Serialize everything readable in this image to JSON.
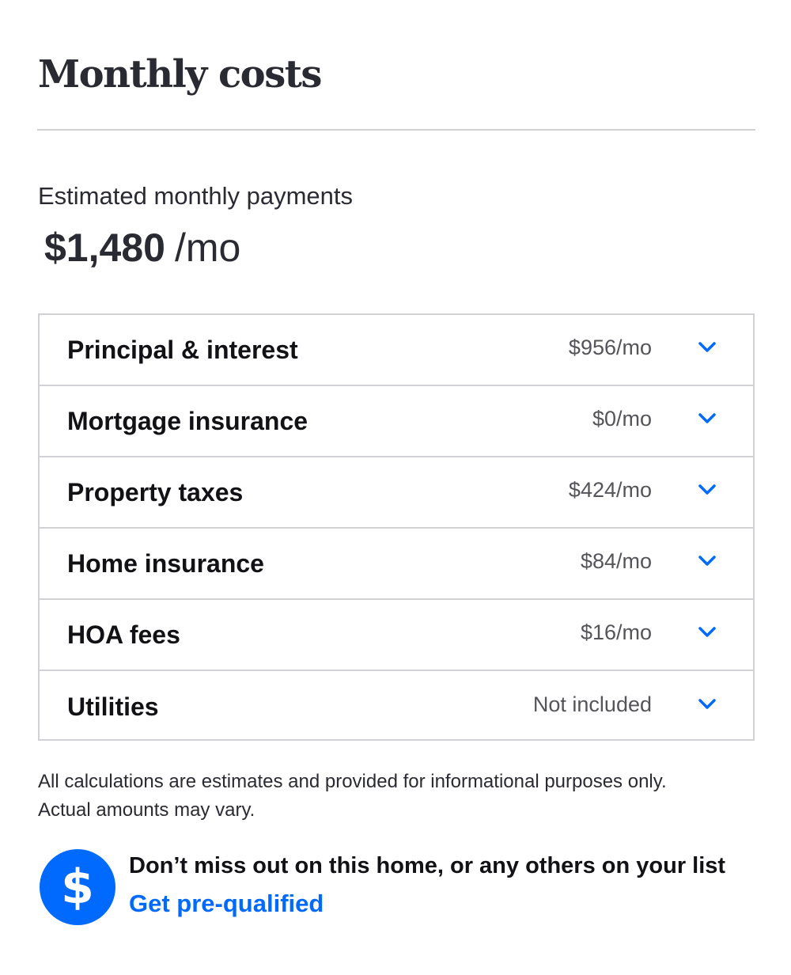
{
  "header": {
    "title": "Monthly costs"
  },
  "summary": {
    "label": "Estimated monthly payments",
    "amount": "$1,480",
    "unit": "/mo"
  },
  "costs": [
    {
      "label": "Principal & interest",
      "value": "$956/mo"
    },
    {
      "label": "Mortgage insurance",
      "value": "$0/mo"
    },
    {
      "label": "Property taxes",
      "value": "$424/mo"
    },
    {
      "label": "Home insurance",
      "value": "$84/mo"
    },
    {
      "label": "HOA fees",
      "value": "$16/mo"
    },
    {
      "label": "Utilities",
      "value": "Not included"
    }
  ],
  "disclaimer": {
    "line1": "All calculations are estimates and provided for informational purposes only.",
    "line2": "Actual amounts may vary."
  },
  "promo": {
    "icon": "dollar-icon",
    "icon_glyph": "$",
    "text": "Don’t miss out on this home, or any others on your list",
    "link_label": "Get pre-qualified"
  },
  "colors": {
    "accent": "#006aff",
    "text": "#2a2a33",
    "border": "#d1d1d5"
  }
}
